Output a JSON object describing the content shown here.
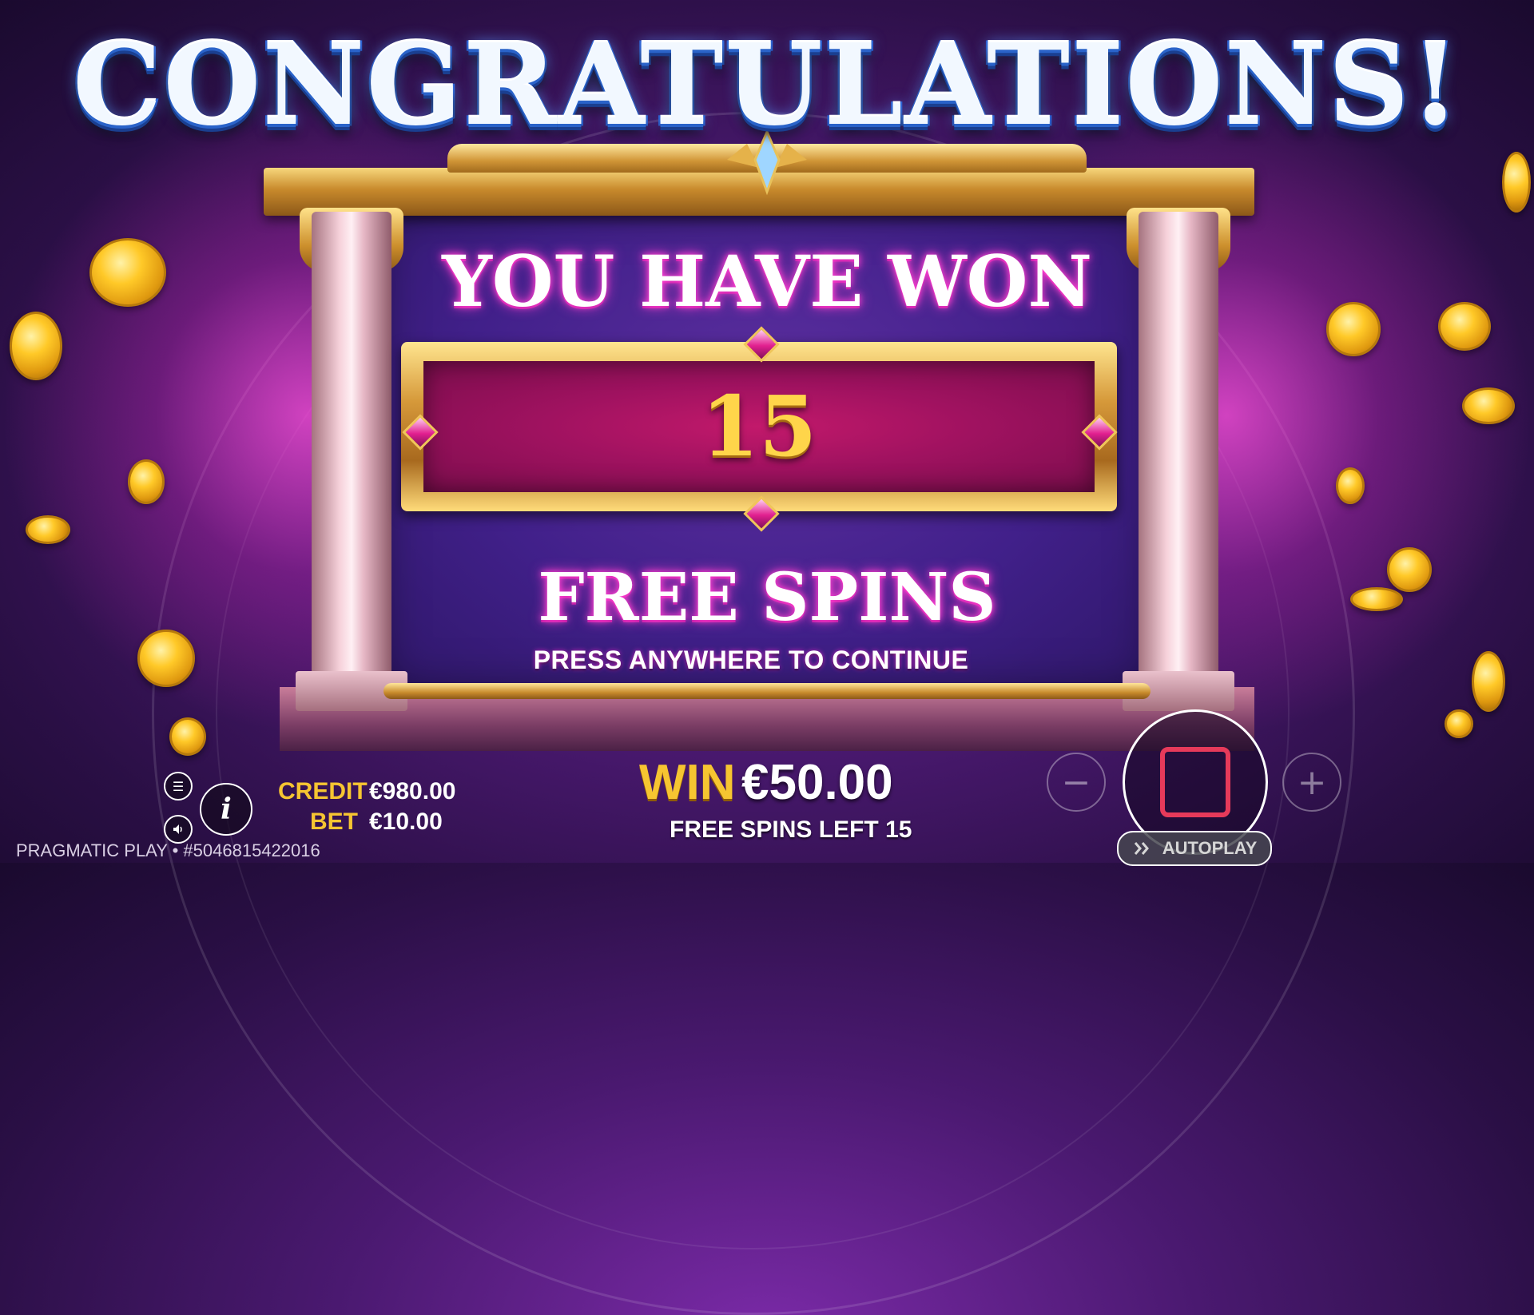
{
  "popup": {
    "title": "CONGRATULATIONS!",
    "heading": "YOU HAVE WON",
    "spins_count": "15",
    "subheading": "FREE SPINS",
    "instruction": "PRESS ANYWHERE TO CONTINUE"
  },
  "hud": {
    "credit_label": "CREDIT",
    "credit_value": "€980.00",
    "bet_label": "BET",
    "bet_value": "€10.00",
    "win_label": "WIN",
    "win_value": "€50.00",
    "free_spins_left": "FREE SPINS LEFT 15",
    "minus_label": "−",
    "plus_label": "+",
    "autoplay_label": "AUTOPLAY",
    "info_label": "i"
  },
  "footer": {
    "text": "PRAGMATIC PLAY • #5046815422016"
  },
  "icons": {
    "menu": "menu-icon",
    "sound": "speaker-icon",
    "stop": "stop-icon",
    "autoplay": "autoplay-icon"
  },
  "colors": {
    "accent_gold": "#f6c531",
    "magenta_glow": "#ff3fd0",
    "stop_red": "#e63a5a",
    "title_blue": "#2a5fd0"
  }
}
